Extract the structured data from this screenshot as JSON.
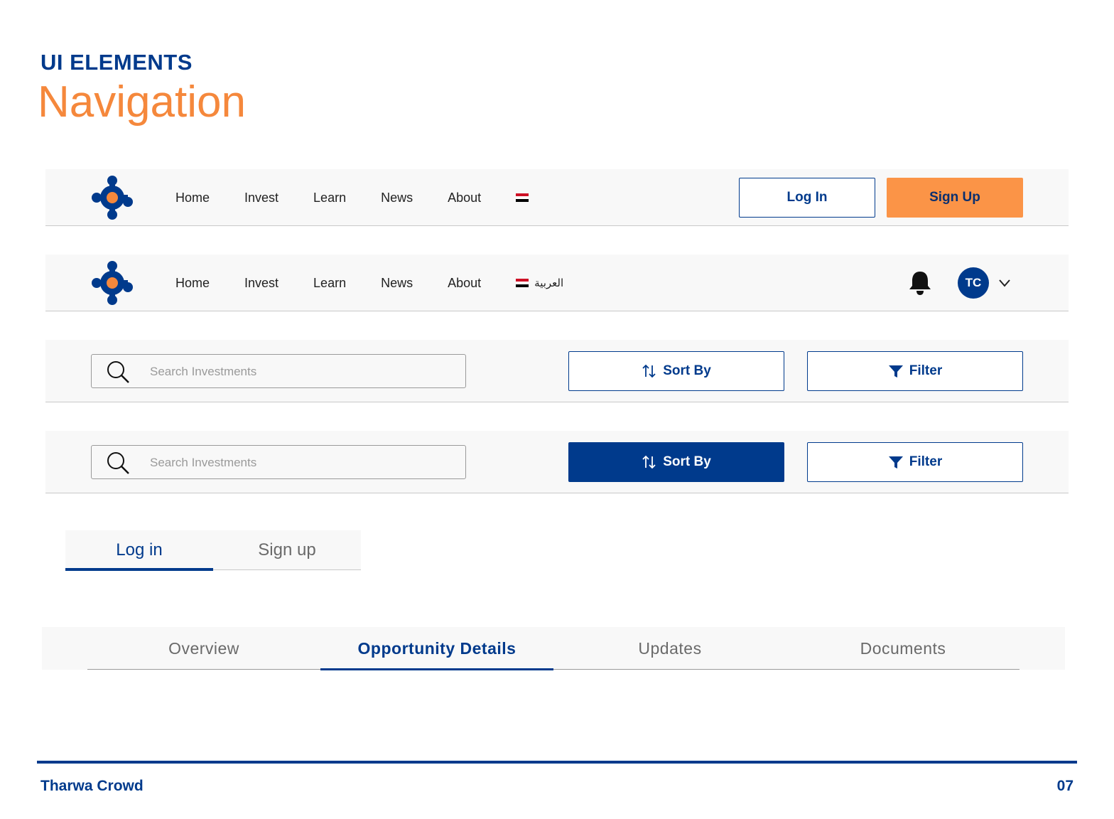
{
  "header": {
    "kicker": "UI ELEMENTS",
    "title": "Navigation"
  },
  "colors": {
    "brand_blue": "#003a8c",
    "brand_orange": "#f5883c",
    "signup_orange": "#fb9447",
    "bar_bg": "#f8f8f8"
  },
  "nav_public": {
    "links": [
      "Home",
      "Invest",
      "Learn",
      "News",
      "About"
    ],
    "login_label": "Log In",
    "signup_label": "Sign Up"
  },
  "nav_user": {
    "links": [
      "Home",
      "Invest",
      "Learn",
      "News",
      "About"
    ],
    "language_label": "العربية",
    "avatar_initials": "TC",
    "icons": [
      "bell-icon",
      "chevron-down-icon"
    ]
  },
  "toolbar_default": {
    "search_placeholder": "Search Investments",
    "sort_label": "Sort By",
    "filter_label": "Filter"
  },
  "toolbar_active": {
    "search_placeholder": "Search Investments",
    "sort_label": "Sort By",
    "filter_label": "Filter"
  },
  "auth_tabs": {
    "login": "Log in",
    "signup": "Sign up",
    "active": "Log in"
  },
  "detail_tabs": {
    "items": [
      "Overview",
      "Opportunity Details",
      "Updates",
      "Documents"
    ],
    "active": "Opportunity Details"
  },
  "footer": {
    "brand": "Tharwa Crowd",
    "page": "07"
  }
}
